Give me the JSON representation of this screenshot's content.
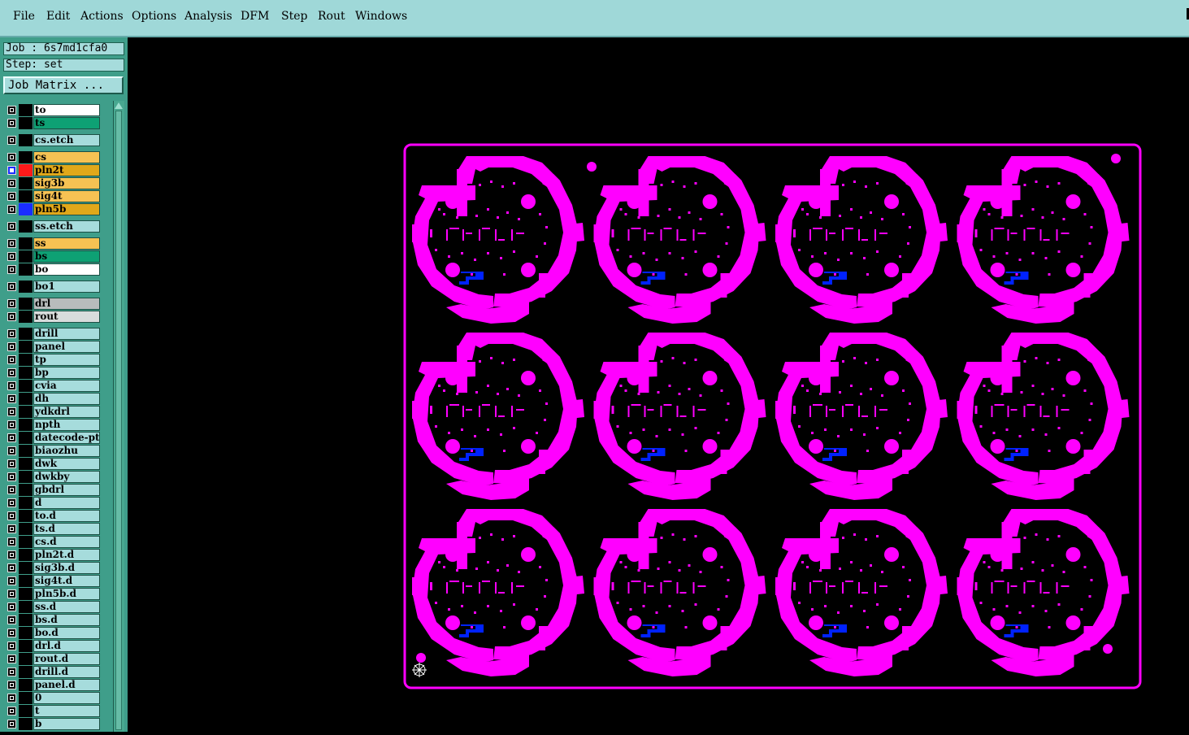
{
  "menu": [
    "File",
    "Edit",
    "Actions",
    "Options",
    "Analysis",
    "DFM",
    "Step",
    "Rout",
    "Windows"
  ],
  "job_label": "Job : 6s7md1cfa0",
  "step_label": "Step: set",
  "job_matrix_button": "Job Matrix ...",
  "colors": {
    "menu_bg": "#9fd8d8",
    "panel_bg": "#3f9e8a",
    "layer_default": "#a6dcdc",
    "layer_white": "#ffffff",
    "layer_green": "#0ea174",
    "layer_yellow": "#f6c253",
    "layer_gold": "#e0a81a",
    "layer_grey": "#b8bcbc",
    "layer_lightgrey": "#d8dcdc",
    "board": "#ff00ff",
    "feature_blue": "#0022ff"
  },
  "layers": [
    {
      "name": "to",
      "color": "layer_white"
    },
    {
      "name": "ts",
      "color": "layer_green"
    },
    {
      "name": "cs.etch",
      "color": "layer_default"
    },
    {
      "name": "cs",
      "color": "layer_yellow"
    },
    {
      "name": "pln2t",
      "color": "layer_gold",
      "swatch": "#ff1a1a",
      "selected": true,
      "flag": "⊞"
    },
    {
      "name": "sig3b",
      "color": "layer_yellow"
    },
    {
      "name": "sig4t",
      "color": "layer_yellow"
    },
    {
      "name": "pln5b",
      "color": "layer_gold",
      "swatch": "#1a2dff"
    },
    {
      "name": "ss.etch",
      "color": "layer_default"
    },
    {
      "name": "ss",
      "color": "layer_yellow"
    },
    {
      "name": "bs",
      "color": "layer_green"
    },
    {
      "name": "bo",
      "color": "layer_white"
    },
    {
      "name": "bo1",
      "color": "layer_default"
    },
    {
      "name": "drl",
      "color": "layer_grey"
    },
    {
      "name": "rout",
      "color": "layer_lightgrey"
    },
    {
      "name": "drill",
      "color": "layer_default"
    },
    {
      "name": "panel",
      "color": "layer_default"
    },
    {
      "name": "tp",
      "color": "layer_default"
    },
    {
      "name": "bp",
      "color": "layer_default"
    },
    {
      "name": "cvia",
      "color": "layer_default"
    },
    {
      "name": "dh",
      "color": "layer_default"
    },
    {
      "name": "ydkdrl",
      "color": "layer_default"
    },
    {
      "name": "npth",
      "color": "layer_default"
    },
    {
      "name": "datecode-ptc",
      "color": "layer_default"
    },
    {
      "name": "biaozhu",
      "color": "layer_default"
    },
    {
      "name": "dwk",
      "color": "layer_default"
    },
    {
      "name": "dwkby",
      "color": "layer_default"
    },
    {
      "name": "gbdrl",
      "color": "layer_default"
    },
    {
      "name": "d",
      "color": "layer_default"
    },
    {
      "name": "to.d",
      "color": "layer_default",
      "flag": "✎"
    },
    {
      "name": "ts.d",
      "color": "layer_default",
      "flag": "✎"
    },
    {
      "name": "cs.d",
      "color": "layer_default",
      "flag": "✎"
    },
    {
      "name": "pln2t.d",
      "color": "layer_default",
      "flag": "✎"
    },
    {
      "name": "sig3b.d",
      "color": "layer_default",
      "flag": "✎"
    },
    {
      "name": "sig4t.d",
      "color": "layer_default",
      "flag": "✎"
    },
    {
      "name": "pln5b.d",
      "color": "layer_default",
      "flag": "✎"
    },
    {
      "name": "ss.d",
      "color": "layer_default",
      "flag": "✎"
    },
    {
      "name": "bs.d",
      "color": "layer_default",
      "flag": "✎"
    },
    {
      "name": "bo.d",
      "color": "layer_default",
      "flag": "✎"
    },
    {
      "name": "drl.d",
      "color": "layer_default"
    },
    {
      "name": "rout.d",
      "color": "layer_default"
    },
    {
      "name": "drill.d",
      "color": "layer_default",
      "flag": "✎"
    },
    {
      "name": "panel.d",
      "color": "layer_default",
      "flag": "✎"
    },
    {
      "name": "0",
      "color": "layer_default"
    },
    {
      "name": "t",
      "color": "layer_default"
    },
    {
      "name": "b",
      "color": "layer_default"
    }
  ],
  "panel_grid": {
    "columns": 4,
    "rows": 3
  }
}
